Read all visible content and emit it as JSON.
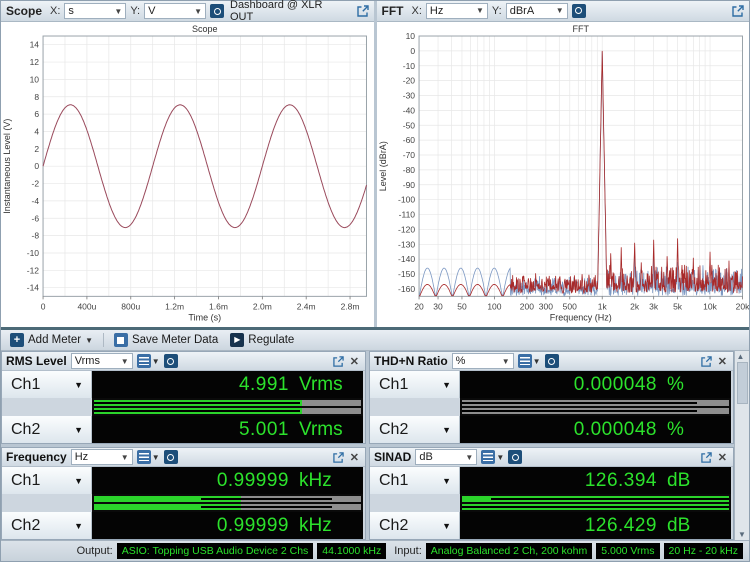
{
  "colors": {
    "green_text": "#2ce22c",
    "bar_green": "#2bd42b",
    "display_bg": "#040404",
    "scope_trace": "#9a4a5c",
    "fft_trace_ch1": "#7b97c2",
    "fft_trace_ch2": "#a82a2a"
  },
  "scope_panel": {
    "title": "Scope",
    "x_label": "X:",
    "x_value": "s",
    "y_label": "Y:",
    "y_value": "V",
    "nav_label": "Dashboard @ XLR OUT"
  },
  "fft_panel": {
    "title": "FFT",
    "x_label": "X:",
    "x_value": "Hz",
    "y_label": "Y:",
    "y_value": "dBrA"
  },
  "toolbar": {
    "add_meter": "Add Meter",
    "save_meter_data": "Save Meter Data",
    "regulate": "Regulate"
  },
  "meters": [
    {
      "title": "RMS Level",
      "unit": "Vrms",
      "channels": [
        {
          "name": "Ch1",
          "value": "4.991",
          "unit": "Vrms",
          "bar": {
            "fill": 78,
            "line": [
              0,
              77
            ]
          }
        },
        {
          "name": "Ch2",
          "value": "5.001",
          "unit": "Vrms",
          "bar": {
            "fill": 78,
            "line": [
              0,
              77
            ]
          }
        }
      ]
    },
    {
      "title": "THD+N Ratio",
      "unit": "%",
      "channels": [
        {
          "name": "Ch1",
          "value": "0.000048",
          "unit": "%",
          "bar": {
            "fill": 0,
            "line": [
              0,
              88
            ]
          }
        },
        {
          "name": "Ch2",
          "value": "0.000048",
          "unit": "%",
          "bar": {
            "fill": 0,
            "line": [
              0,
              88
            ]
          }
        }
      ]
    },
    {
      "title": "Frequency",
      "unit": "Hz",
      "channels": [
        {
          "name": "Ch1",
          "value": "0.99999",
          "unit": "kHz",
          "bar": {
            "fill": 55,
            "line": [
              40,
              89
            ]
          }
        },
        {
          "name": "Ch2",
          "value": "0.99999",
          "unit": "kHz",
          "bar": {
            "fill": 55,
            "line": [
              40,
              89
            ]
          }
        }
      ]
    },
    {
      "title": "SINAD",
      "unit": "dB",
      "channels": [
        {
          "name": "Ch1",
          "value": "126.394",
          "unit": "dB",
          "bar": {
            "fill": 100,
            "line": [
              11,
              100
            ]
          }
        },
        {
          "name": "Ch2",
          "value": "126.429",
          "unit": "dB",
          "bar": {
            "fill": 100,
            "line": [
              0,
              100
            ]
          }
        }
      ]
    }
  ],
  "status_bar": {
    "output_label": "Output:",
    "output_badges": [
      "ASIO: Topping USB Audio Device 2 Chs",
      "44.1000 kHz"
    ],
    "input_label": "Input:",
    "input_badges": [
      "Analog Balanced 2 Ch, 200 kohm",
      "5.000 Vrms",
      "20 Hz - 20 kHz"
    ]
  },
  "chart_data": [
    {
      "id": "scope",
      "type": "line",
      "title": "Scope",
      "xlabel": "Time (s)",
      "ylabel": "Instantaneous Level (V)",
      "xlim": [
        0,
        0.00295
      ],
      "ylim": [
        -15,
        15
      ],
      "grid": true,
      "grid_dx": 0.0002,
      "grid_dy": 2,
      "xticks": [
        {
          "v": 0,
          "label": "0"
        },
        {
          "v": 0.0004,
          "label": "400u"
        },
        {
          "v": 0.0008,
          "label": "800u"
        },
        {
          "v": 0.0012,
          "label": "1.2m"
        },
        {
          "v": 0.0016,
          "label": "1.6m"
        },
        {
          "v": 0.002,
          "label": "2.0m"
        },
        {
          "v": 0.0024,
          "label": "2.4m"
        },
        {
          "v": 0.0028,
          "label": "2.8m"
        }
      ],
      "yticks": [
        14,
        12,
        10,
        8,
        6,
        4,
        2,
        0,
        -2,
        -4,
        -6,
        -8,
        -10,
        -12,
        -14
      ],
      "series": [
        {
          "name": "Ch1",
          "color": "#9a4a5c",
          "waveform": "sine",
          "amplitude_V": 7.07,
          "frequency_Hz": 1000,
          "phase_deg": 0
        }
      ]
    },
    {
      "id": "fft",
      "type": "line",
      "title": "FFT",
      "xlabel": "Frequency (Hz)",
      "ylabel": "Level (dBrA)",
      "xscale": "log",
      "xlim": [
        20,
        20000
      ],
      "ylim": [
        -165,
        10
      ],
      "grid": true,
      "xticks": [
        {
          "v": 20,
          "label": "20"
        },
        {
          "v": 30,
          "label": "30"
        },
        {
          "v": 50,
          "label": "50"
        },
        {
          "v": 100,
          "label": "100"
        },
        {
          "v": 200,
          "label": "200"
        },
        {
          "v": 300,
          "label": "300"
        },
        {
          "v": 500,
          "label": "500"
        },
        {
          "v": 1000,
          "label": "1k"
        },
        {
          "v": 2000,
          "label": "2k"
        },
        {
          "v": 3000,
          "label": "3k"
        },
        {
          "v": 5000,
          "label": "5k"
        },
        {
          "v": 10000,
          "label": "10k"
        },
        {
          "v": 20000,
          "label": "20k"
        }
      ],
      "yticks": [
        10,
        0,
        -10,
        -20,
        -30,
        -40,
        -50,
        -60,
        -70,
        -80,
        -90,
        -100,
        -110,
        -120,
        -130,
        -140,
        -150,
        -160
      ],
      "series": [
        {
          "name": "Ch1",
          "color": "#7b97c2",
          "noise_floor_dB": -160,
          "lobe_peak_dB": -146,
          "peaks": [
            [
              1000,
              -0.5
            ],
            [
              2000,
              -136
            ],
            [
              3000,
              -139
            ],
            [
              5000,
              -142
            ]
          ]
        },
        {
          "name": "Ch2",
          "color": "#a82a2a",
          "noise_floor_dB": -158,
          "lobe_peak_dB": -157,
          "peaks": [
            [
              1000,
              0
            ],
            [
              1200,
              -136
            ],
            [
              1500,
              -132
            ],
            [
              2000,
              -129
            ],
            [
              3000,
              -127
            ],
            [
              4000,
              -138
            ],
            [
              5000,
              -126
            ],
            [
              7000,
              -139
            ],
            [
              10000,
              -135
            ],
            [
              15000,
              -141
            ]
          ]
        }
      ]
    }
  ]
}
